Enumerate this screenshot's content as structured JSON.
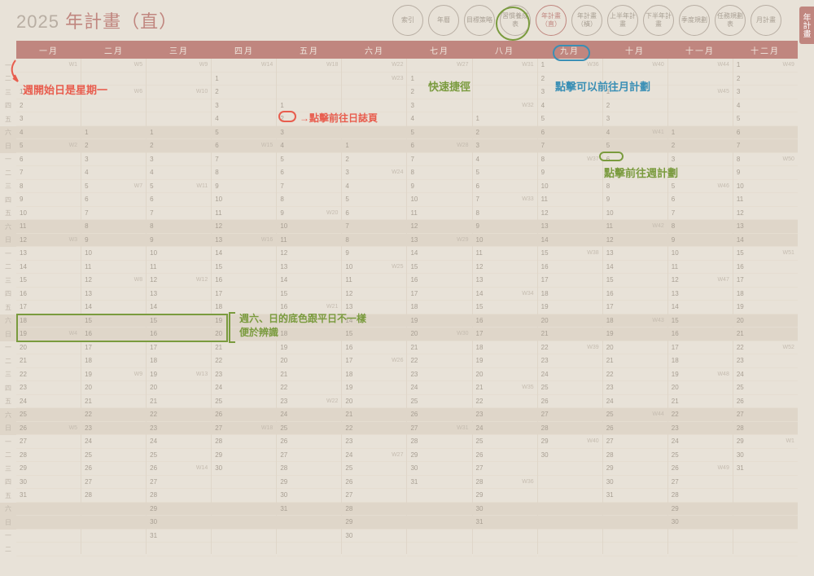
{
  "title_year": "2025",
  "title_text": "年計畫（直）",
  "side_tab": "年計畫",
  "nav": [
    "索引",
    "年曆",
    "目標策略",
    "習慣養成表",
    "年計畫（直）",
    "年計畫（橫）",
    "上半年計畫",
    "下半年計畫",
    "季度規劃",
    "任務規劃表",
    "月計畫"
  ],
  "nav_active": 4,
  "months": [
    "一月",
    "二月",
    "三月",
    "四月",
    "五月",
    "六月",
    "七月",
    "八月",
    "九月",
    "十月",
    "十一月",
    "十二月"
  ],
  "day_labels": [
    "一",
    "二",
    "三",
    "四",
    "五",
    "六",
    "日",
    "一",
    "二",
    "三",
    "四",
    "五",
    "六",
    "日",
    "一",
    "二",
    "三",
    "四",
    "五",
    "六",
    "日",
    "一",
    "二",
    "三",
    "四",
    "五",
    "六",
    "日",
    "一",
    "二",
    "三",
    "四",
    "五",
    "六",
    "日",
    "一",
    "二"
  ],
  "weekend_rows": [
    5,
    6,
    12,
    13,
    19,
    20,
    26,
    27,
    33,
    34
  ],
  "month_start_dow": [
    2,
    5,
    5,
    1,
    3,
    6,
    1,
    4,
    0,
    2,
    5,
    0
  ],
  "month_len": [
    31,
    28,
    31,
    30,
    31,
    30,
    31,
    31,
    30,
    31,
    30,
    31
  ],
  "weeks_by_month": {
    "0": [
      [
        "W1",
        0
      ],
      [
        "W2",
        6
      ],
      [
        "W3",
        13
      ],
      [
        "W4",
        20
      ],
      [
        "W5",
        27
      ]
    ],
    "1": [
      [
        "W5",
        0
      ],
      [
        "W6",
        2
      ],
      [
        "W7",
        9
      ],
      [
        "W8",
        16
      ],
      [
        "W9",
        23
      ]
    ],
    "2": [
      [
        "W9",
        0
      ],
      [
        "W10",
        2
      ],
      [
        "W11",
        9
      ],
      [
        "W12",
        16
      ],
      [
        "W13",
        23
      ],
      [
        "W14",
        30
      ]
    ],
    "3": [
      [
        "W14",
        0
      ],
      [
        "W15",
        6
      ],
      [
        "W16",
        13
      ],
      [
        "W17",
        20
      ],
      [
        "W18",
        27
      ]
    ],
    "4": [
      [
        "W18",
        0
      ],
      [
        "W19",
        4
      ],
      [
        "W20",
        11
      ],
      [
        "W21",
        18
      ],
      [
        "W22",
        25
      ]
    ],
    "5": [
      [
        "W22",
        0
      ],
      [
        "W23",
        1
      ],
      [
        "W24",
        8
      ],
      [
        "W25",
        15
      ],
      [
        "W26",
        22
      ],
      [
        "W27",
        29
      ]
    ],
    "6": [
      [
        "W27",
        0
      ],
      [
        "W28",
        6
      ],
      [
        "W29",
        13
      ],
      [
        "W30",
        20
      ],
      [
        "W31",
        27
      ]
    ],
    "7": [
      [
        "W31",
        0
      ],
      [
        "W32",
        3
      ],
      [
        "W33",
        10
      ],
      [
        "W34",
        17
      ],
      [
        "W35",
        24
      ],
      [
        "W36",
        31
      ]
    ],
    "8": [
      [
        "W36",
        0
      ],
      [
        "W37",
        7
      ],
      [
        "W38",
        14
      ],
      [
        "W39",
        21
      ],
      [
        "W40",
        28
      ]
    ],
    "9": [
      [
        "W40",
        0
      ],
      [
        "W41",
        5
      ],
      [
        "W42",
        12
      ],
      [
        "W43",
        19
      ],
      [
        "W44",
        26
      ]
    ],
    "10": [
      [
        "W44",
        0
      ],
      [
        "W45",
        2
      ],
      [
        "W46",
        9
      ],
      [
        "W47",
        16
      ],
      [
        "W48",
        23
      ],
      [
        "W49",
        30
      ]
    ],
    "11": [
      [
        "W49",
        0
      ],
      [
        "W50",
        7
      ],
      [
        "W51",
        14
      ],
      [
        "W52",
        21
      ],
      [
        "W1",
        28
      ]
    ]
  },
  "annotations": {
    "a1": "週開始日是星期一",
    "a2": "點擊前往日誌頁",
    "a3": "快速捷徑",
    "a4": "點擊可以前往月計劃",
    "a5": "點擊前往週計劃",
    "a6_l1": "週六、日的底色跟平日不一樣",
    "a6_l2": "便於辨識"
  }
}
